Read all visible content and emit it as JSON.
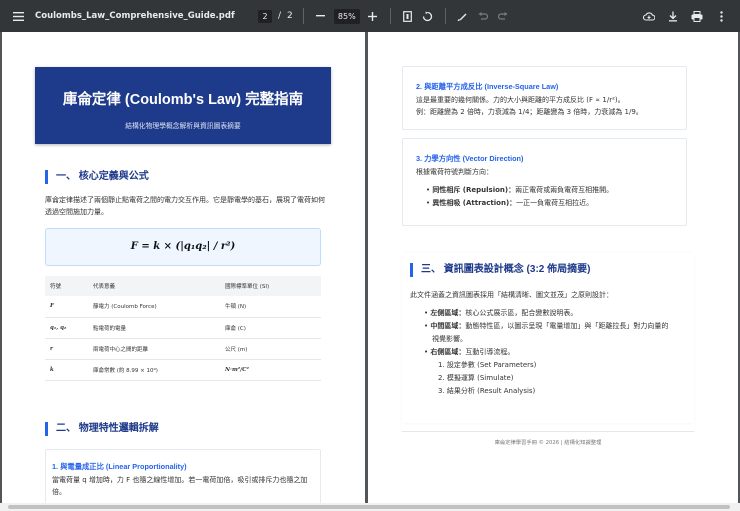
{
  "toolbar": {
    "filename": "Coulombs_Law_Comprehensive_Guide.pdf",
    "current_page": "2",
    "page_sep": "/",
    "total_pages": "2",
    "zoom": "85%",
    "icons": [
      "menu-icon",
      "zoom-out-icon",
      "zoom-in-icon",
      "fit-page-icon",
      "rotate-icon",
      "annotate-icon",
      "undo-icon",
      "redo-icon",
      "drive-save-icon",
      "download-icon",
      "print-icon",
      "more-icon"
    ]
  },
  "left_page": {
    "banner_title": "庫侖定律 (Coulomb's Law) 完整指南",
    "banner_subtitle": "結構化物理學概念解析與資訊圖表摘要",
    "section1_title": "一、 核心定義與公式",
    "section1_body": "庫侖定律描述了兩個靜止點電荷之間的電力交互作用。它是靜電學的基石，展現了電荷如何透過空間施加力量。",
    "formula": "F = k × (|q₁q₂| / r²)",
    "table_headers": [
      "符號",
      "代表意義",
      "國際標準單位 (SI)"
    ],
    "table_rows": [
      [
        "F",
        "靜電力 (Coulomb Force)",
        "牛頓 (N)"
      ],
      [
        "q₁, q₂",
        "點電荷的電量",
        "庫侖 (C)"
      ],
      [
        "r",
        "兩電荷中心之間的距離",
        "公尺 (m)"
      ],
      [
        "k",
        "庫侖常數 (約 8.99 × 10⁹)",
        "N·m²/C²"
      ]
    ],
    "section2_title": "二、 物理特性邏輯拆解",
    "sub1_title": "1. 與電量成正比 (Linear Proportionality)",
    "sub1_body": "當電荷量 q 增加時，力 F 也隨之線性增加。若一電荷加倍，吸引或排斥力也隨之加倍。"
  },
  "right_page": {
    "sub2_title": "2. 與距離平方成反比 (Inverse-Square Law)",
    "sub2_body1": "這是最重要的幾何關係。力的大小與距離的平方成反比 (F ∝ 1/r²)。",
    "sub2_body2": "例：距離變為 2 倍時，力衰減為 1/4；距離變為 3 倍時，力衰減為 1/9。",
    "sub3_title": "3. 力學方向性 (Vector Direction)",
    "sub3_intro": "根據電荷符號判斷方向：",
    "sub3_bullets": [
      {
        "term": "同性相斥 (Repulsion)：",
        "desc": "兩正電荷或兩負電荷互相推開。"
      },
      {
        "term": "異性相吸 (Attraction)：",
        "desc": "一正一負電荷互相拉近。"
      }
    ],
    "section3_title": "三、 資訊圖表設計概念 (3:2 佈局摘要)",
    "section3_intro": "此文件涵蓋之資訊圖表採用「結構清晰、圖文並茂」之原則設計：",
    "section3_bullets": [
      {
        "term": "左側區域：",
        "desc": "核心公式展示區，配合變數說明表。"
      },
      {
        "term": "中間區域：",
        "desc": "動態特性區，以圖示呈現「電量增加」與「距離拉長」對力向量的"
      },
      {
        "term": "",
        "desc": "視覺影響。"
      },
      {
        "term": "右側區域：",
        "desc": "互動引導流程。"
      }
    ],
    "steps": [
      "1. 設定參數 (Set Parameters)",
      "2. 模擬運算 (Simulate)",
      "3. 結果分析 (Result Analysis)"
    ],
    "footer": "庫侖定律學習手冊 © 2026 | 結構化知識整理"
  }
}
